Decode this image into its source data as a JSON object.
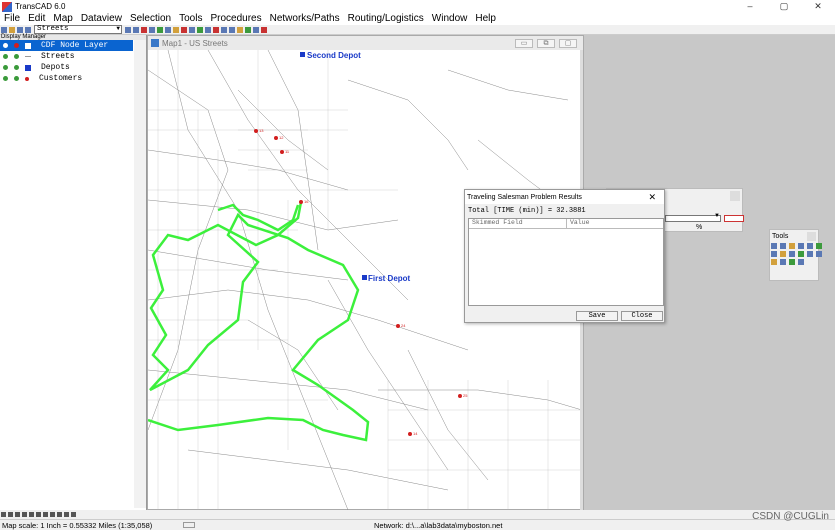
{
  "window": {
    "title": "TransCAD 6.0",
    "controls": [
      "–",
      "▢",
      "✕"
    ]
  },
  "menu": [
    "File",
    "Edit",
    "Map",
    "Dataview",
    "Selection",
    "Tools",
    "Procedures",
    "Networks/Paths",
    "Routing/Logistics",
    "Window",
    "Help"
  ],
  "toolbar": {
    "layer_select": "Streets"
  },
  "display_manager": {
    "title": "Display Manager",
    "layers": [
      {
        "name": "CDF Node Layer",
        "active": true
      },
      {
        "name": "Streets",
        "active": false
      },
      {
        "name": "Depots",
        "active": false
      },
      {
        "name": "Customers",
        "active": false
      }
    ]
  },
  "map": {
    "title": "Map1 - US Streets",
    "depots": [
      "Second Depot",
      "First Depot"
    ],
    "customers": [
      "13",
      "12",
      "11",
      "16",
      "24",
      "25",
      "14"
    ]
  },
  "dialog": {
    "title": "Traveling Salesman Problem Results",
    "total": "Total [TIME (min)] = 32.3881",
    "columns": [
      "Skimmed Field",
      "Value"
    ],
    "save_label": "Save",
    "close_label": "Close"
  },
  "float_panel": {
    "pct": "%"
  },
  "tools": {
    "title": "Tools"
  },
  "status": {
    "scale": "Map scale: 1 Inch = 0.55332 Miles (1:35,058)",
    "network": "Network: d:\\...a\\lab3data\\myboston.net"
  },
  "watermark": "CSDN @CUGLin",
  "colors": {
    "route": "#3cf03c",
    "depot": "#1a3ac8",
    "customer": "#d21e1e",
    "selection": "#0a64d0"
  }
}
